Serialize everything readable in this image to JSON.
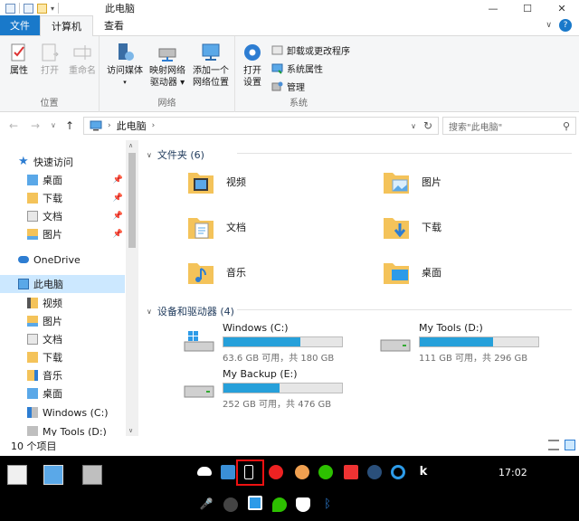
{
  "window": {
    "title": "此电脑"
  },
  "tabs": {
    "file": "文件",
    "computer": "计算机",
    "view": "查看"
  },
  "ribbon": {
    "location": {
      "label": "位置",
      "properties": "属性",
      "open": "打开",
      "rename": "重命名"
    },
    "network": {
      "label": "网络",
      "access_media": "访问媒体",
      "map_drive_1": "映射网络",
      "map_drive_2": "驱动器",
      "add_location_1": "添加一个",
      "add_location_2": "网络位置"
    },
    "system": {
      "label": "系统",
      "open_settings_1": "打开",
      "open_settings_2": "设置",
      "uninstall": "卸载或更改程序",
      "system_props": "系统属性",
      "manage": "管理"
    }
  },
  "address": {
    "path": "此电脑",
    "search_placeholder": "搜索\"此电脑\""
  },
  "nav": {
    "quick_access": "快速访问",
    "items": [
      "桌面",
      "下载",
      "文档",
      "图片"
    ],
    "onedrive": "OneDrive",
    "this_pc": "此电脑",
    "pc_items": [
      "视频",
      "图片",
      "文档",
      "下载",
      "音乐",
      "桌面",
      "Windows (C:)",
      "My Tools (D:)"
    ]
  },
  "folders": {
    "header": "文件夹 (6)",
    "items": [
      "视频",
      "图片",
      "文档",
      "下载",
      "音乐",
      "桌面"
    ]
  },
  "drives": {
    "header": "设备和驱动器 (4)",
    "items": [
      {
        "name": "Windows (C:)",
        "free": "63.6 GB 可用，共 180 GB",
        "used_fraction": 0.65
      },
      {
        "name": "My Tools (D:)",
        "free": "111 GB 可用，共 296 GB",
        "used_fraction": 0.62
      },
      {
        "name": "My Backup (E:)",
        "free": "252 GB 可用，共 476 GB",
        "used_fraction": 0.47
      }
    ]
  },
  "status": {
    "count": "10 个项目"
  },
  "taskbar": {
    "clock": "17:02"
  },
  "colors": {
    "accent": "#1979ca",
    "selection": "#cce8ff",
    "drive_fill": "#26a0da",
    "folder": "#f4c35a"
  }
}
